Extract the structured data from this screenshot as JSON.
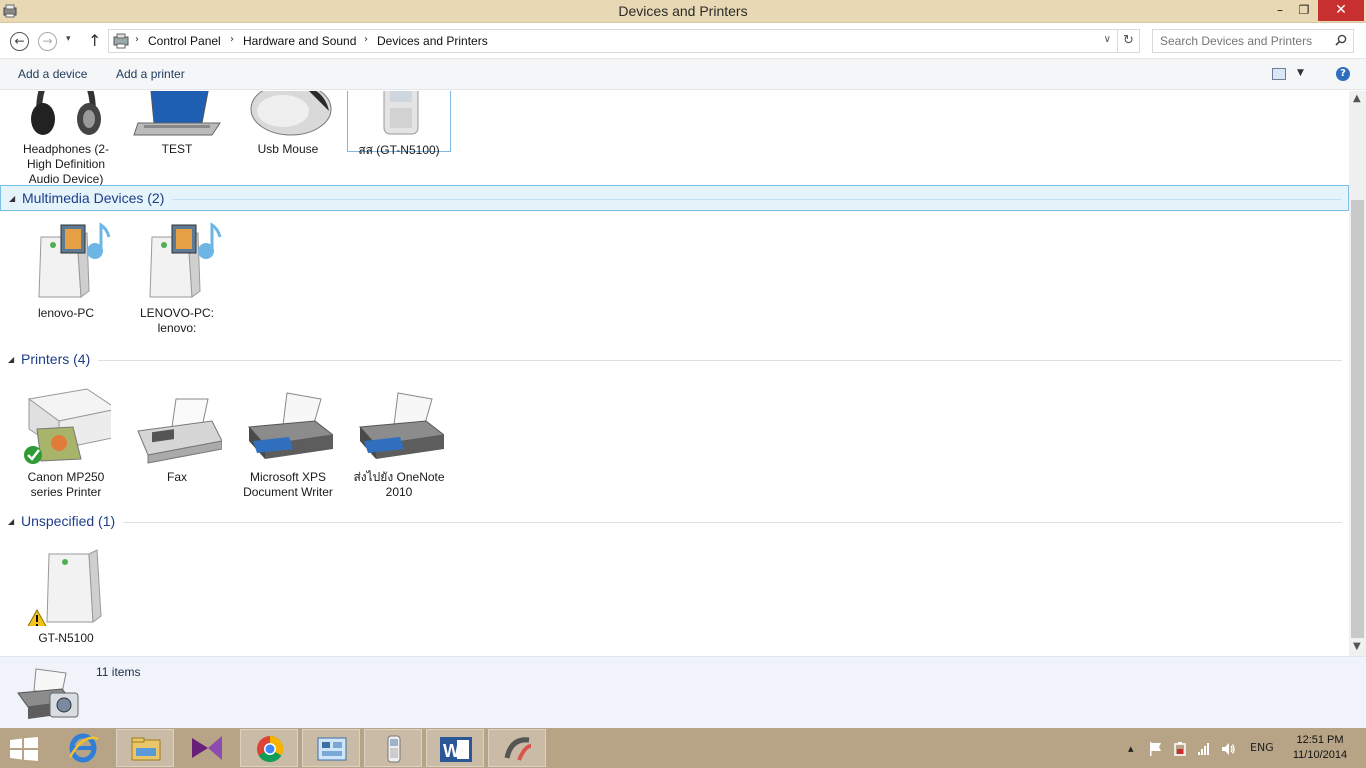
{
  "window": {
    "title": "Devices and Printers"
  },
  "controls": {
    "minimize": "–",
    "maximize": "❐",
    "close": "✕"
  },
  "nav": {
    "back_glyph": "←",
    "forward_glyph": "→",
    "history_glyph": "▾",
    "up_glyph": "↑",
    "separator": "›",
    "breadcrumb": [
      "Control Panel",
      "Hardware and Sound",
      "Devices and Printers"
    ],
    "address_drop_glyph": "∨",
    "refresh_glyph": "↻"
  },
  "search": {
    "placeholder": "Search Devices and Printers"
  },
  "commands": {
    "add_device": "Add a device",
    "add_printer": "Add a printer",
    "help": "?"
  },
  "groups": {
    "devices": {
      "items": [
        "Headphones (2- High Definition Audio Device)",
        "TEST",
        "Usb Mouse",
        "สส (GT-N5100)"
      ]
    },
    "multimedia": {
      "title": "Multimedia Devices (2)",
      "items": [
        "lenovo-PC",
        "LENOVO-PC: lenovo:"
      ]
    },
    "printers": {
      "title": "Printers (4)",
      "items": [
        "Canon MP250 series Printer",
        "Fax",
        "Microsoft XPS Document Writer",
        "ส่งไปยัง OneNote 2010"
      ]
    },
    "unspecified": {
      "title": "Unspecified (1)",
      "items": [
        "GT-N5100"
      ]
    }
  },
  "details": {
    "count": "11 items"
  },
  "taskbar": {
    "apps": [
      "start-icon",
      "internet-explorer-icon",
      "file-explorer-icon",
      "visual-studio-icon",
      "chrome-icon",
      "control-panel-icon",
      "phone-icon",
      "word-icon",
      "app-icon"
    ],
    "tray_expand": "▴",
    "language": "ENG",
    "time": "12:51 PM",
    "date": "11/10/2014"
  },
  "colors": {
    "titlebar": "#e8d9b4",
    "taskbar": "#b7a487",
    "close": "#c7302f",
    "group_title": "#1e3e8a"
  }
}
